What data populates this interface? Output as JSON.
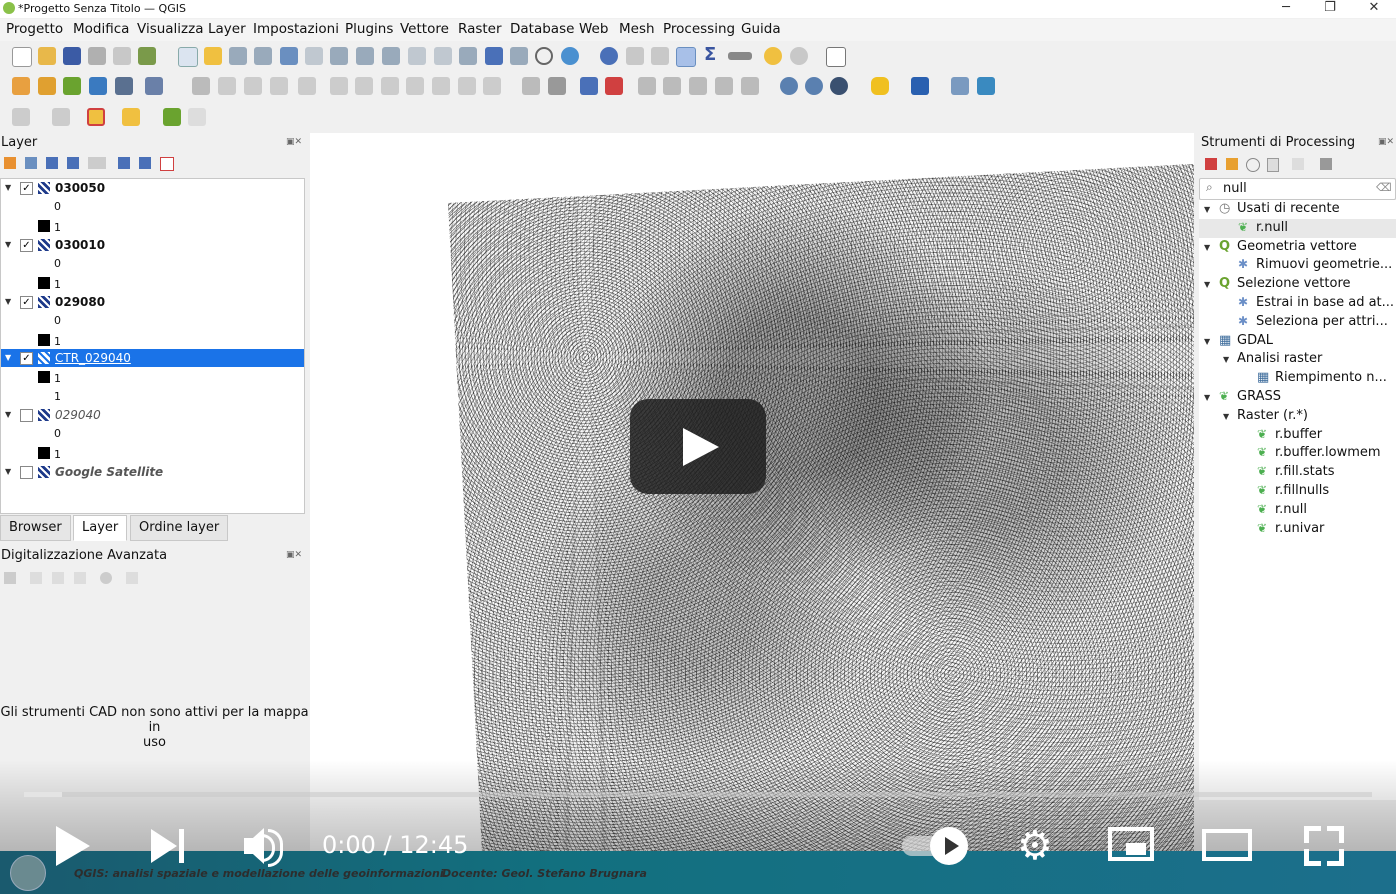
{
  "window": {
    "title": "*Progetto Senza Titolo — QGIS",
    "minimize": "─",
    "restore": "❐",
    "close": "✕"
  },
  "menu": [
    "Progetto",
    "Modifica",
    "Visualizza",
    "Layer",
    "Impostazioni",
    "Plugins",
    "Vettore",
    "Raster",
    "Database",
    "Web",
    "Mesh",
    "Processing",
    "Guida"
  ],
  "layers_panel": {
    "title": "Layer",
    "items": [
      {
        "name": "030050",
        "checked": true,
        "bold": true,
        "classes": [
          "0",
          "1"
        ]
      },
      {
        "name": "030010",
        "checked": true,
        "bold": true,
        "classes": [
          "0",
          "1"
        ]
      },
      {
        "name": "029080",
        "checked": true,
        "bold": true,
        "classes": [
          "0",
          "1"
        ]
      },
      {
        "name": "CTR_029040",
        "checked": true,
        "selected": true,
        "classes": [
          "1",
          "1"
        ]
      },
      {
        "name": "029040",
        "checked": false,
        "italic": true,
        "classes": [
          "0",
          "1"
        ]
      },
      {
        "name": "Google Satellite",
        "checked": false,
        "italic": true,
        "bold": true,
        "classes": []
      }
    ],
    "tabs": [
      "Browser",
      "Layer",
      "Ordine layer"
    ],
    "active_tab": "Layer"
  },
  "digitizing_panel": {
    "title": "Digitalizzazione Avanzata",
    "message_line1": "Gli strumenti CAD non sono attivi per la mappa in",
    "message_line2": "uso"
  },
  "processing_panel": {
    "title": "Strumenti di Processing",
    "search_value": "null",
    "tree": [
      {
        "label": "Usati di recente",
        "level": 0,
        "icon": "clock-icon",
        "expanded": true
      },
      {
        "label": "r.null",
        "level": 1,
        "icon": "grass-icon",
        "highlight": true
      },
      {
        "label": "Geometria vettore",
        "level": 0,
        "icon": "qgis-icon",
        "expanded": true
      },
      {
        "label": "Rimuovi geometrie...",
        "level": 1,
        "icon": "gear-icon"
      },
      {
        "label": "Selezione vettore",
        "level": 0,
        "icon": "qgis-icon",
        "expanded": true
      },
      {
        "label": "Estrai in base ad at...",
        "level": 1,
        "icon": "gear-icon"
      },
      {
        "label": "Seleziona per attri...",
        "level": 1,
        "icon": "gear-icon"
      },
      {
        "label": "GDAL",
        "level": 0,
        "icon": "gdal-icon",
        "expanded": true
      },
      {
        "label": "Analisi raster",
        "level": 1,
        "icon": "",
        "expanded": true
      },
      {
        "label": "Riempimento n...",
        "level": 2,
        "icon": "gdal-icon"
      },
      {
        "label": "GRASS",
        "level": 0,
        "icon": "grass-icon",
        "expanded": true
      },
      {
        "label": "Raster (r.*)",
        "level": 1,
        "icon": "",
        "expanded": true
      },
      {
        "label": "r.buffer",
        "level": 2,
        "icon": "grass-icon"
      },
      {
        "label": "r.buffer.lowmem",
        "level": 2,
        "icon": "grass-icon"
      },
      {
        "label": "r.fill.stats",
        "level": 2,
        "icon": "grass-icon"
      },
      {
        "label": "r.fillnulls",
        "level": 2,
        "icon": "grass-icon"
      },
      {
        "label": "r.null",
        "level": 2,
        "icon": "grass-icon"
      },
      {
        "label": "r.univar",
        "level": 2,
        "icon": "grass-icon"
      }
    ]
  },
  "video": {
    "time_current": "0:00",
    "time_separator": " / ",
    "time_total": "12:45",
    "progress_loaded_fraction": 0.028,
    "banner_title": "QGIS: analisi spaziale e modellazione delle geoinformazioni.",
    "banner_teacher": "Docente: Geol. Stefano Brugnara"
  },
  "colors": {
    "selection": "#1a73e8",
    "banner": "#12707f"
  }
}
